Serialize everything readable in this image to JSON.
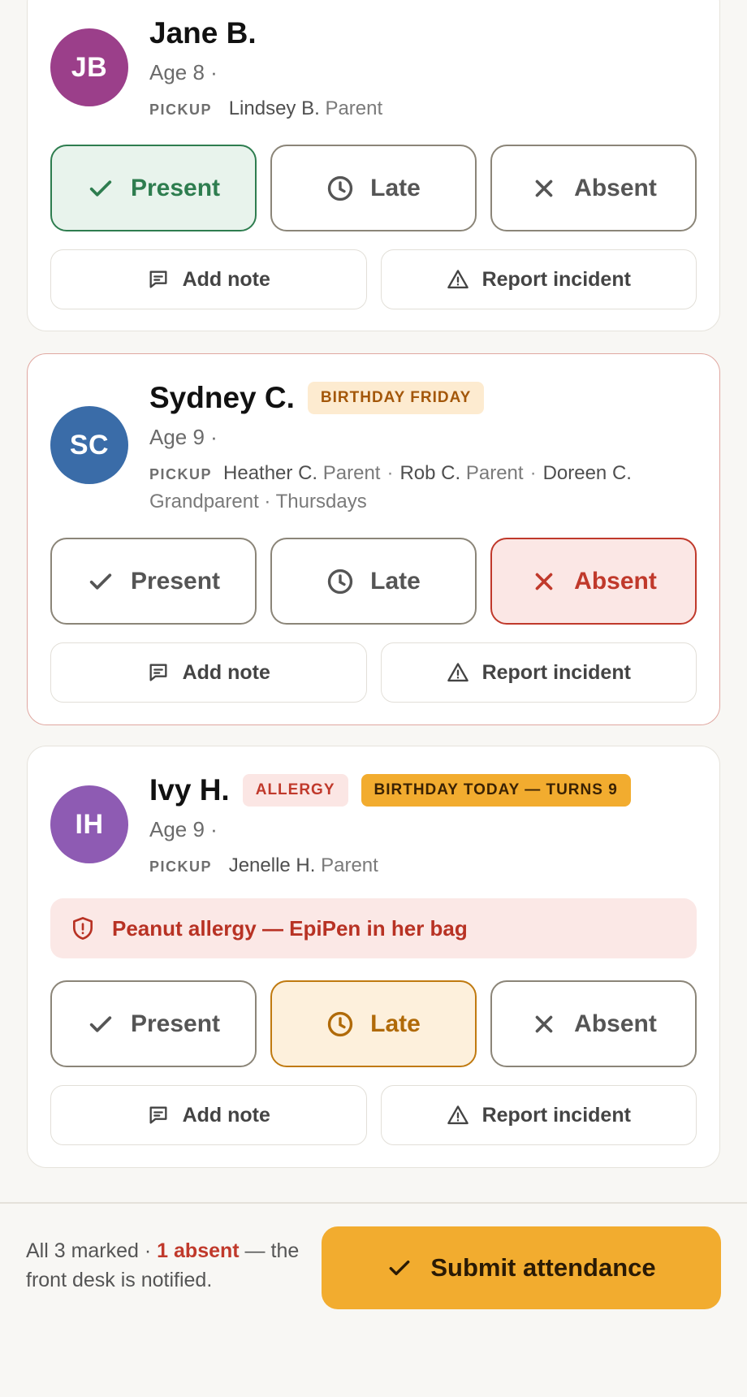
{
  "colors": {
    "accent": "#f2ac2f",
    "present": "#2e7d4f",
    "absent": "#c0392b",
    "late": "#b06a08"
  },
  "status_labels": {
    "present": "Present",
    "late": "Late",
    "absent": "Absent"
  },
  "action_labels": {
    "add_note": "Add note",
    "report_incident": "Report incident"
  },
  "pickup_label": "PICKUP",
  "children": [
    {
      "initials": "JB",
      "avatar_color": "#9b3f8a",
      "name": "Jane B.",
      "age": "Age 8 ·",
      "pickup": [
        {
          "name": "Lindsey B.",
          "relation": "Parent"
        }
      ],
      "status": "present"
    },
    {
      "initials": "SC",
      "avatar_color": "#3a6ca8",
      "name": "Sydney C.",
      "tags": [
        "BIRTHDAY FRIDAY"
      ],
      "age": "Age 9 ·",
      "pickup": [
        {
          "name": "Heather C.",
          "relation": "Parent"
        },
        {
          "name": "Rob C.",
          "relation": "Parent"
        },
        {
          "name": "Doreen C.",
          "relation": "Grandparent · Thursdays"
        }
      ],
      "status": "absent"
    },
    {
      "initials": "IH",
      "avatar_color": "#8e5bb3",
      "name": "Ivy H.",
      "tags": [
        "ALLERGY",
        "BIRTHDAY TODAY — TURNS 9"
      ],
      "age": "Age 9 ·",
      "pickup": [
        {
          "name": "Jenelle H.",
          "relation": "Parent"
        }
      ],
      "allergy_note": "Peanut allergy — EpiPen in her bag",
      "status": "late"
    }
  ],
  "footer": {
    "summary_prefix": "All 3 marked · ",
    "absent_count": "1 absent",
    "summary_suffix": " — the front desk is notified.",
    "submit_label": "Submit attendance"
  }
}
